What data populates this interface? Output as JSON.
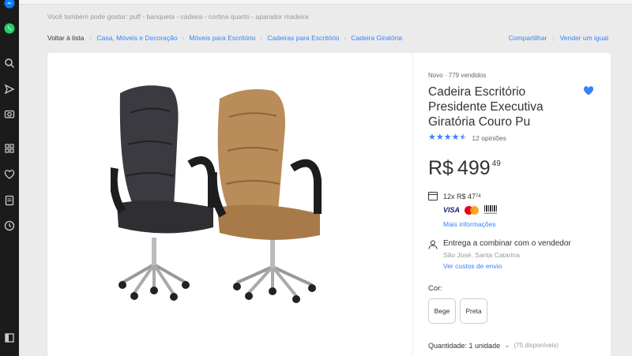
{
  "suggestions": "Você também pode gostar: puff - banqueta - cadeira - cortina quarto - aparador madeira",
  "breadcrumb": {
    "back": "Voltar à lista",
    "items": [
      "Casa, Móveis e Decoração",
      "Móveis para Escritório",
      "Cadeiras para Escritório",
      "Cadeira Giratória"
    ]
  },
  "actions": {
    "share": "Compartilhar",
    "sell": "Vender um igual"
  },
  "product": {
    "condition": "Novo  ·  779 vendidos",
    "title": "Cadeira Escritório Presidente Executiva Giratória Couro Pu",
    "rating": 4.5,
    "reviews": "12 opiniões",
    "currency": "R$",
    "price_int": "499",
    "price_cents": "49",
    "installments_prefix": "12x R$ 47",
    "installments_cents": "74",
    "payment_methods": [
      "VISA",
      "mastercard",
      "Boleto"
    ],
    "more_info": "Mais informações",
    "shipping": "Entrega a combinar com o vendedor",
    "location": "São José, Santa Catarina",
    "shipping_cost": "Ver custos de envio",
    "color_label": "Cor:",
    "colors": [
      "Bege",
      "Preta"
    ],
    "quantity": "Quantidade: 1 unidade",
    "available": "(75 disponíveis)"
  },
  "icons": {
    "leftbar": [
      "messenger-icon",
      "whatsapp-icon",
      "search-icon",
      "send-icon",
      "camera-icon",
      "apps-icon",
      "heart-icon",
      "notes-icon",
      "history-icon",
      "sidebar-toggle-icon"
    ],
    "favorite": "heart-icon"
  },
  "colors": {
    "accent": "#3483fa",
    "leftbar": "#1b1b1b",
    "text": "#333333"
  }
}
